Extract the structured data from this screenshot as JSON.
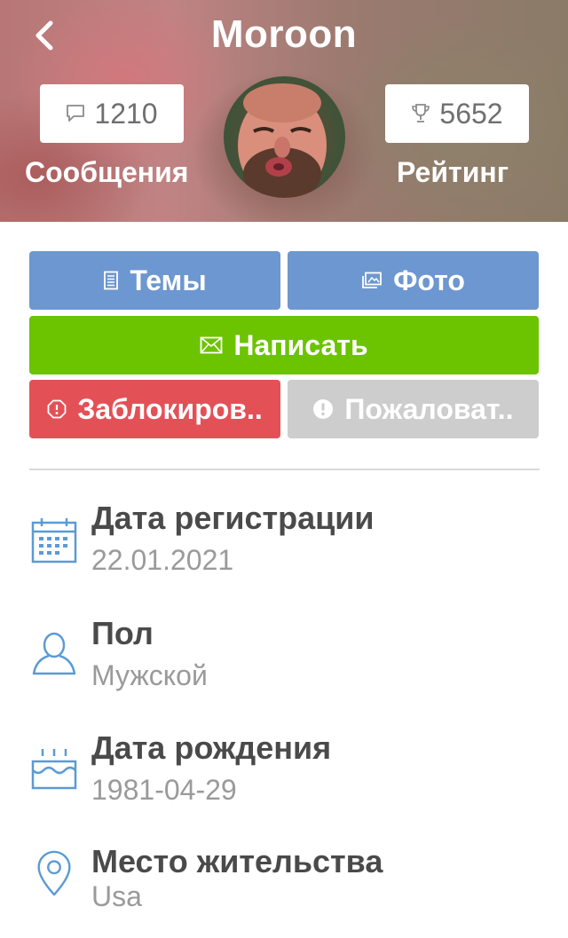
{
  "header": {
    "title": "Moroon",
    "back_icon": "chevron-left-icon",
    "messages": {
      "count": "1210",
      "label": "Сообщения",
      "icon": "speech-bubble-icon"
    },
    "rating": {
      "count": "5652",
      "label": "Рейтинг",
      "icon": "trophy-icon"
    }
  },
  "actions": {
    "topics": {
      "label": "Темы",
      "icon": "document-icon"
    },
    "photo": {
      "label": "Фото",
      "icon": "image-icon"
    },
    "write": {
      "label": "Написать",
      "icon": "envelope-icon"
    },
    "block": {
      "label": "Заблокиров..",
      "icon": "alert-octagon-icon"
    },
    "report": {
      "label": "Пожаловат..",
      "icon": "exclamation-circle-icon"
    }
  },
  "info": [
    {
      "title": "Дата регистрации",
      "value": "22.01.2021",
      "icon": "calendar-icon"
    },
    {
      "title": "Пол",
      "value": "Мужской",
      "icon": "person-icon"
    },
    {
      "title": "Дата рождения",
      "value": "1981-04-29",
      "icon": "cake-icon"
    },
    {
      "title": "Место жительства",
      "value": "Usa",
      "icon": "location-pin-icon"
    }
  ],
  "colors": {
    "blue": "#6d97d0",
    "green": "#6cc300",
    "red": "#e35157",
    "gray": "#cdcdcd",
    "icon_blue": "#5b9bd5"
  }
}
